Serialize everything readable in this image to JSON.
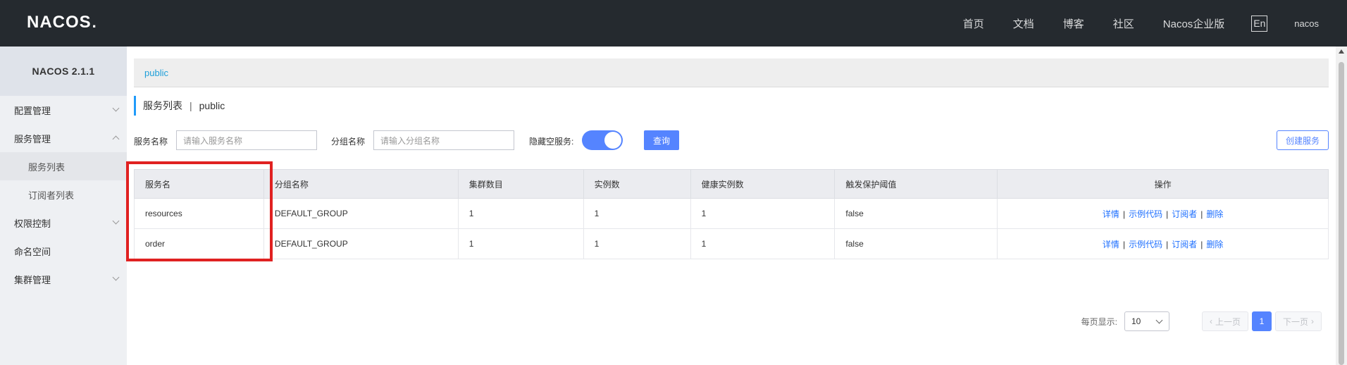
{
  "header": {
    "logo": "NACOS",
    "logo_dot": ".",
    "nav": [
      "首页",
      "文档",
      "博客",
      "社区",
      "Nacos企业版"
    ],
    "lang": "En",
    "user": "nacos"
  },
  "sidebar": {
    "title": "NACOS 2.1.1",
    "items": [
      {
        "label": "配置管理",
        "expanded": false
      },
      {
        "label": "服务管理",
        "expanded": true
      },
      {
        "label": "服务列表",
        "sub": true,
        "active": true
      },
      {
        "label": "订阅者列表",
        "sub": true
      },
      {
        "label": "权限控制",
        "expanded": false
      },
      {
        "label": "命名空间"
      },
      {
        "label": "集群管理",
        "expanded": false
      }
    ]
  },
  "namespace": {
    "current": "public"
  },
  "title": {
    "main": "服务列表",
    "sep": "|",
    "ns": "public"
  },
  "filters": {
    "service_label": "服务名称",
    "service_placeholder": "请输入服务名称",
    "group_label": "分组名称",
    "group_placeholder": "请输入分组名称",
    "hide_empty_label": "隐藏空服务:",
    "hide_empty_on": true,
    "query_button": "查询",
    "create_button": "创建服务"
  },
  "table": {
    "columns": [
      "服务名",
      "分组名称",
      "集群数目",
      "实例数",
      "健康实例数",
      "触发保护阈值",
      "操作"
    ],
    "rows": [
      [
        "resources",
        "DEFAULT_GROUP",
        "1",
        "1",
        "1",
        "false"
      ],
      [
        "order",
        "DEFAULT_GROUP",
        "1",
        "1",
        "1",
        "false"
      ]
    ],
    "actions": [
      "详情",
      "示例代码",
      "订阅者",
      "删除"
    ],
    "action_sep": "|"
  },
  "pagination": {
    "page_size_label": "每页显示:",
    "page_size": "10",
    "prev": "上一页",
    "next": "下一页",
    "current": "1"
  },
  "colors": {
    "accent": "#5584ff",
    "link": "#1e6fff",
    "header_bg": "#252a2f",
    "highlight": "#e02121"
  }
}
